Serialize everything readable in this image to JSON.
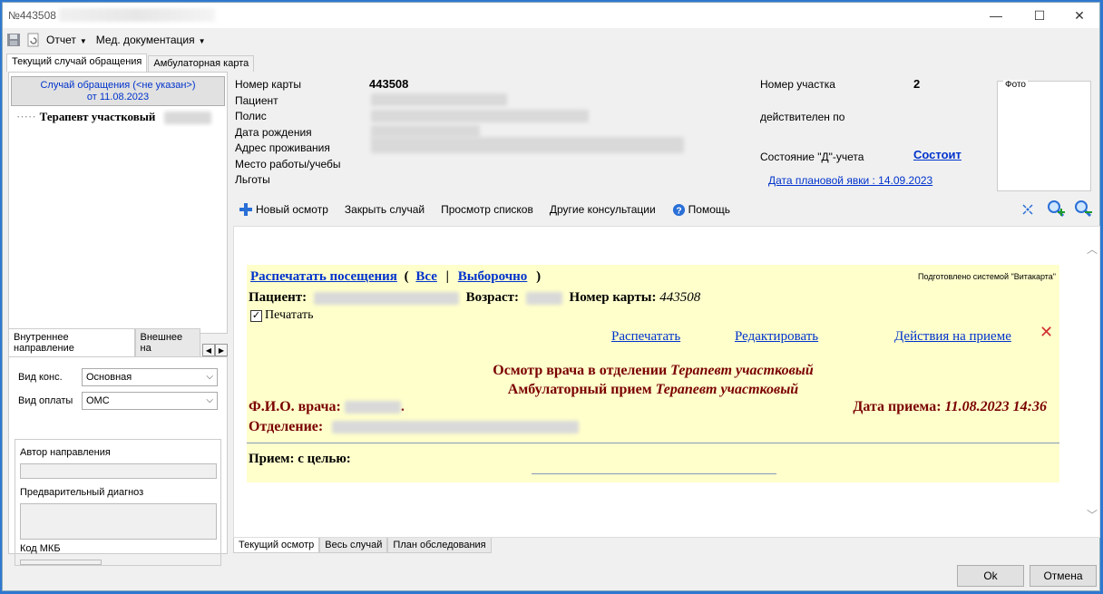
{
  "window": {
    "title": "№443508",
    "minimize": "—",
    "maximize": "☐",
    "close": "✕"
  },
  "menu": {
    "report": "Отчет",
    "meddocs": "Мед. документация"
  },
  "top_tabs": [
    "Текущий случай обращения",
    "Амбулаторная карта"
  ],
  "case": {
    "button_line1": "Случай обращения (<не указан>)",
    "button_line2": "от 11.08.2023",
    "tree_item": "Терапевт участковый"
  },
  "bottom_left": {
    "tabs": [
      "Внутреннее направление",
      "Внешнее на"
    ],
    "vid_kons_label": "Вид конс.",
    "vid_kons_value": "Основная",
    "vid_oplaty_label": "Вид оплаты",
    "vid_oplaty_value": "ОМС",
    "author_label": "Автор направления",
    "diag_label": "Предварительный диагноз",
    "mkb_label": "Код МКБ"
  },
  "patient_info": {
    "card_label": "Номер карты",
    "card_value": "443508",
    "patient_label": "Пациент",
    "policy_label": "Полис",
    "dob_label": "Дата рождения",
    "address_label": "Адрес проживания",
    "work_label": "Место работы/учебы",
    "benefits_label": "Льготы",
    "district_label": "Номер участка",
    "district_value": "2",
    "valid_label": "действителен по",
    "d_status_label": "Состояние \"Д\"-учета",
    "d_status_value": "Состоит",
    "planned_visit": "Дата плановой явки : 14.09.2023",
    "photo_label": "Фото"
  },
  "toolbar": {
    "new_exam": "Новый осмотр",
    "close_case": "Закрыть случай",
    "view_lists": "Просмотр списков",
    "other_consult": "Другие консультации",
    "help": "Помощь"
  },
  "document": {
    "print_visits": "Распечатать посещения",
    "paren_open": "(",
    "all": "Все",
    "sep": "|",
    "selective": "Выборочно",
    "paren_close": ")",
    "prepared_by": "Подготовлено системой \"Витакарта\"",
    "patient_label": "Пациент:",
    "age_label": "Возраст:",
    "card_label": "Номер карты:",
    "card_value": "443508",
    "print_checkbox": "Печатать",
    "print_link": "Распечатать",
    "edit_link": "Редактировать",
    "actions_link": "Действия на приеме",
    "heading1_prefix": "Осмотр врача в отделении",
    "heading1_spec": "Терапевт участковый",
    "heading2_prefix": "Амбулаторный прием",
    "heading2_spec": "Терапевт участковый",
    "doctor_label": "Ф.И.О. врача:",
    "date_label": "Дата приема:",
    "date_value": "11.08.2023 14:36",
    "dept_label": "Отделение:",
    "purpose_label": "Прием: с целью:"
  },
  "doc_tabs": [
    "Текущий осмотр",
    "Весь случай",
    "План обследования"
  ],
  "buttons": {
    "ok": "Ok",
    "cancel": "Отмена"
  },
  "colors": {
    "link": "#0033cc",
    "heading": "#7a0000",
    "doc_background": "#ffffcc",
    "frame": "#2f78d0"
  }
}
